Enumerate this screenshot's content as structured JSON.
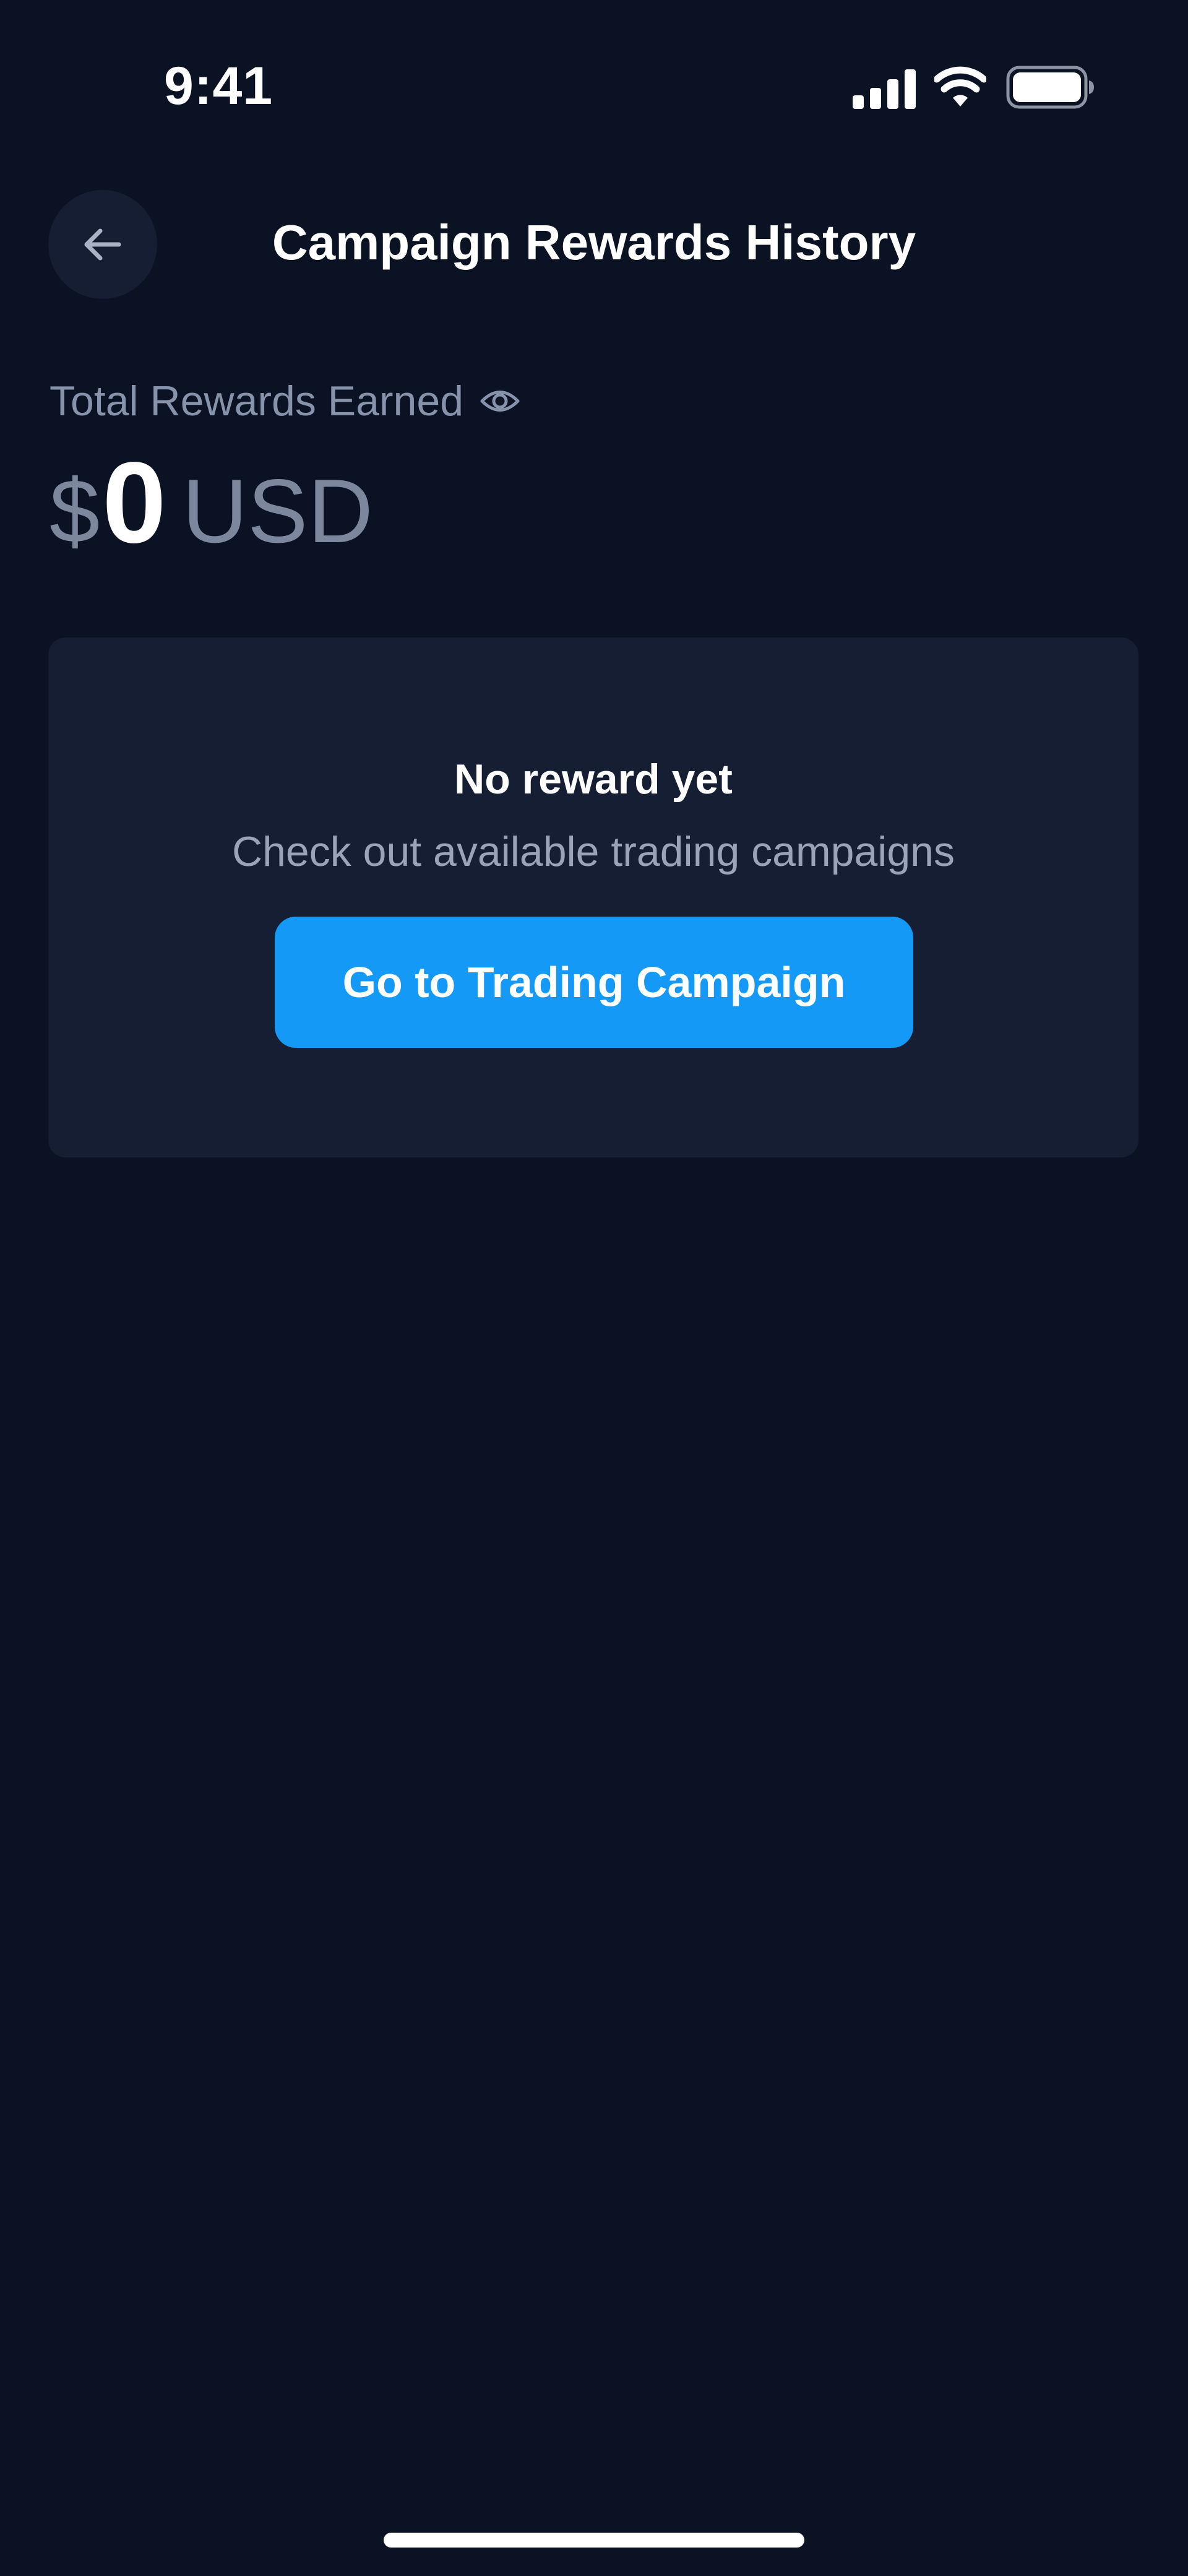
{
  "status_bar": {
    "time": "9:41",
    "icons": [
      "signal-icon",
      "wifi-icon",
      "battery-icon"
    ]
  },
  "header": {
    "back_icon": "arrow-left-icon",
    "title": "Campaign Rewards History"
  },
  "total_rewards": {
    "label": "Total Rewards Earned",
    "visibility_icon": "eye-icon",
    "currency_symbol": "$",
    "amount": "0",
    "currency": "USD"
  },
  "empty_state": {
    "title": "No reward yet",
    "subtitle": "Check out available trading campaigns",
    "button_label": "Go to Trading Campaign"
  },
  "colors": {
    "background": "#0b1224",
    "card": "#161e33",
    "accent": "#1499f7",
    "muted_text": "#8792ab"
  }
}
